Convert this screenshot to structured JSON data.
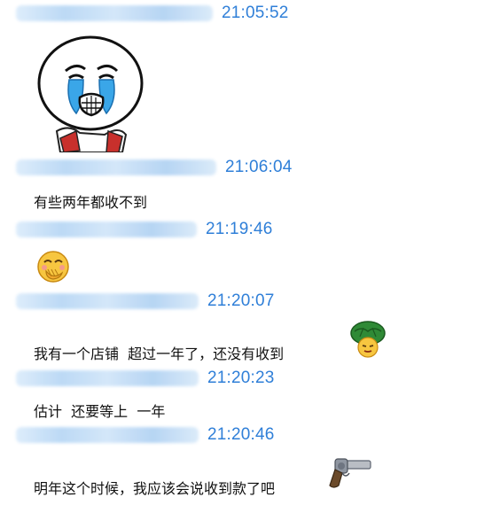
{
  "messages": [
    {
      "sender": "",
      "time": "21:05:52",
      "type": "sticker",
      "sticker": "crying-face-sticker"
    },
    {
      "sender": "",
      "time": "21:06:04",
      "type": "text",
      "text": "有些两年都收不到"
    },
    {
      "sender": "",
      "time": "21:19:46",
      "type": "emoji",
      "emoji": "laughing-covering-mouth-emoji"
    },
    {
      "sender": "",
      "time": "21:20:07",
      "type": "text",
      "text": "我有一个店铺  超过一年了，还没有收到",
      "trailing_emoji": "turtle-hat-emoji"
    },
    {
      "sender": "",
      "time": "21:20:23",
      "type": "text",
      "text": "估计  还要等上  一年"
    },
    {
      "sender": "",
      "time": "21:20:46",
      "type": "text",
      "text": "明年这个时候，我应该会说收到款了吧",
      "trailing_emoji": "revolver-gun-emoji"
    }
  ],
  "colors": {
    "timestamp": "#2f7fd8",
    "text": "#111111",
    "background": "#ffffff"
  }
}
